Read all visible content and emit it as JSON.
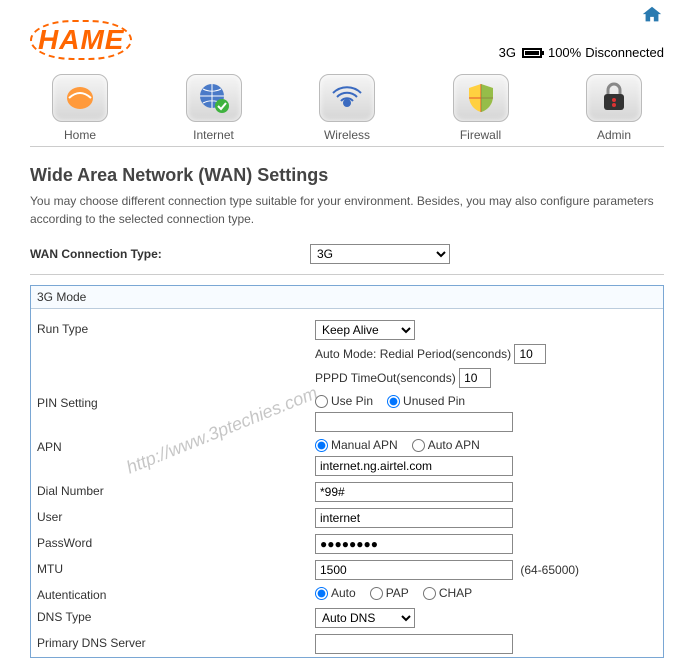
{
  "status": {
    "mode": "3G",
    "percent": "100%",
    "state": "Disconnected"
  },
  "nav": {
    "home": "Home",
    "internet": "Internet",
    "wireless": "Wireless",
    "firewall": "Firewall",
    "admin": "Admin"
  },
  "page": {
    "title": "Wide Area Network (WAN) Settings",
    "desc": "You may choose different connection type suitable for your environment. Besides, you may also configure parameters according to the selected connection type."
  },
  "wan": {
    "label": "WAN Connection Type:",
    "value": "3G"
  },
  "panel_head": "3G Mode",
  "form": {
    "run_type": {
      "label": "Run Type",
      "sel": "Keep Alive",
      "line_a": "Auto Mode: Redial Period(senconds)",
      "val_a": "10",
      "line_b": "PPPD TimeOut(senconds)",
      "val_b": "10"
    },
    "pin": {
      "label": "PIN Setting",
      "opt_a": "Use Pin",
      "opt_b": "Unused Pin",
      "value": ""
    },
    "apn": {
      "label": "APN",
      "opt_a": "Manual APN",
      "opt_b": "Auto APN",
      "value": "internet.ng.airtel.com"
    },
    "dial": {
      "label": "Dial Number",
      "value": "*99#"
    },
    "user": {
      "label": "User",
      "value": "internet"
    },
    "password": {
      "label": "PassWord",
      "value": "●●●●●●●●"
    },
    "mtu": {
      "label": "MTU",
      "value": "1500",
      "range": "(64-65000)"
    },
    "auth": {
      "label": "Autentication",
      "opt_a": "Auto",
      "opt_b": "PAP",
      "opt_c": "CHAP"
    },
    "dns_type": {
      "label": "DNS Type",
      "value": "Auto DNS"
    },
    "pri_dns": {
      "label": "Primary DNS Server",
      "value": ""
    }
  },
  "watermark": "http://www.3ptechies.com"
}
